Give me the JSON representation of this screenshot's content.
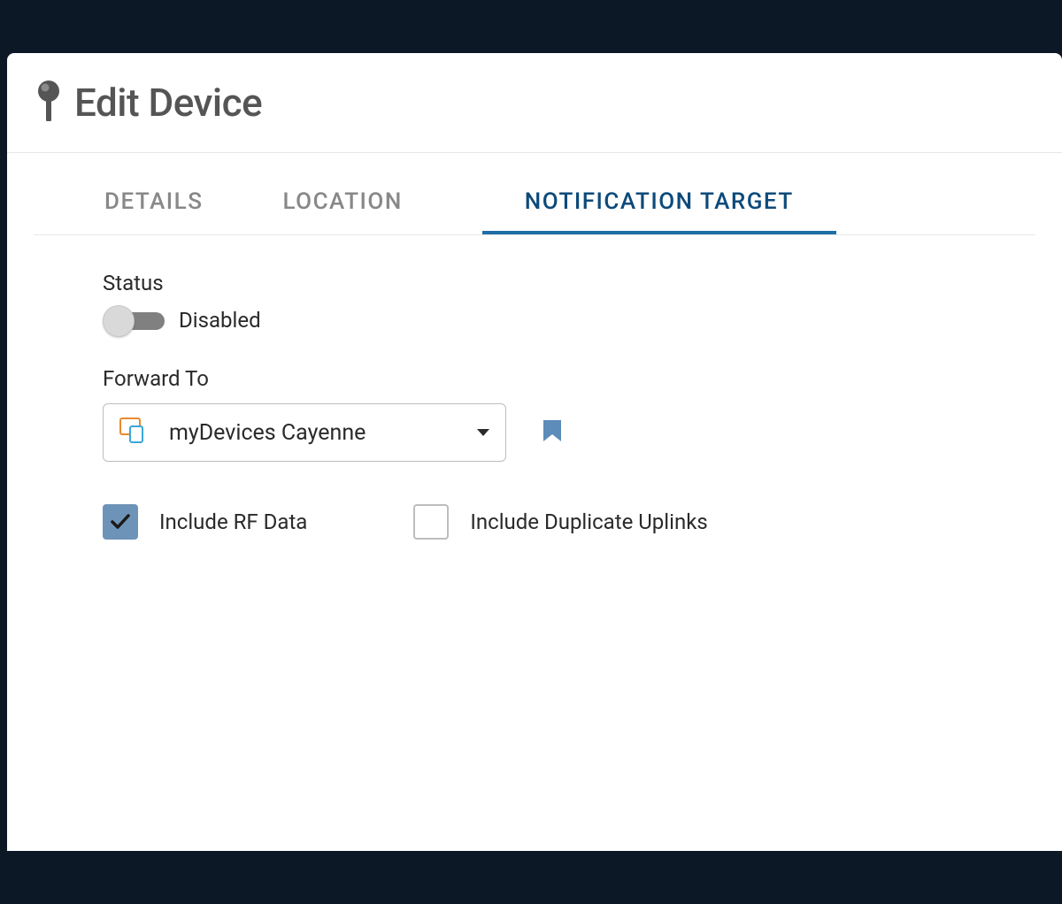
{
  "header": {
    "title": "Edit Device"
  },
  "tabs": [
    {
      "label": "DETAILS",
      "active": false
    },
    {
      "label": "LOCATION",
      "active": false
    },
    {
      "label": "NOTIFICATION TARGET",
      "active": true
    }
  ],
  "form": {
    "status_label": "Status",
    "status_value": "Disabled",
    "status_enabled": false,
    "forward_to_label": "Forward To",
    "forward_to_value": "myDevices Cayenne",
    "include_rf_label": "Include RF Data",
    "include_rf_checked": true,
    "include_dup_label": "Include Duplicate Uplinks",
    "include_dup_checked": false
  }
}
